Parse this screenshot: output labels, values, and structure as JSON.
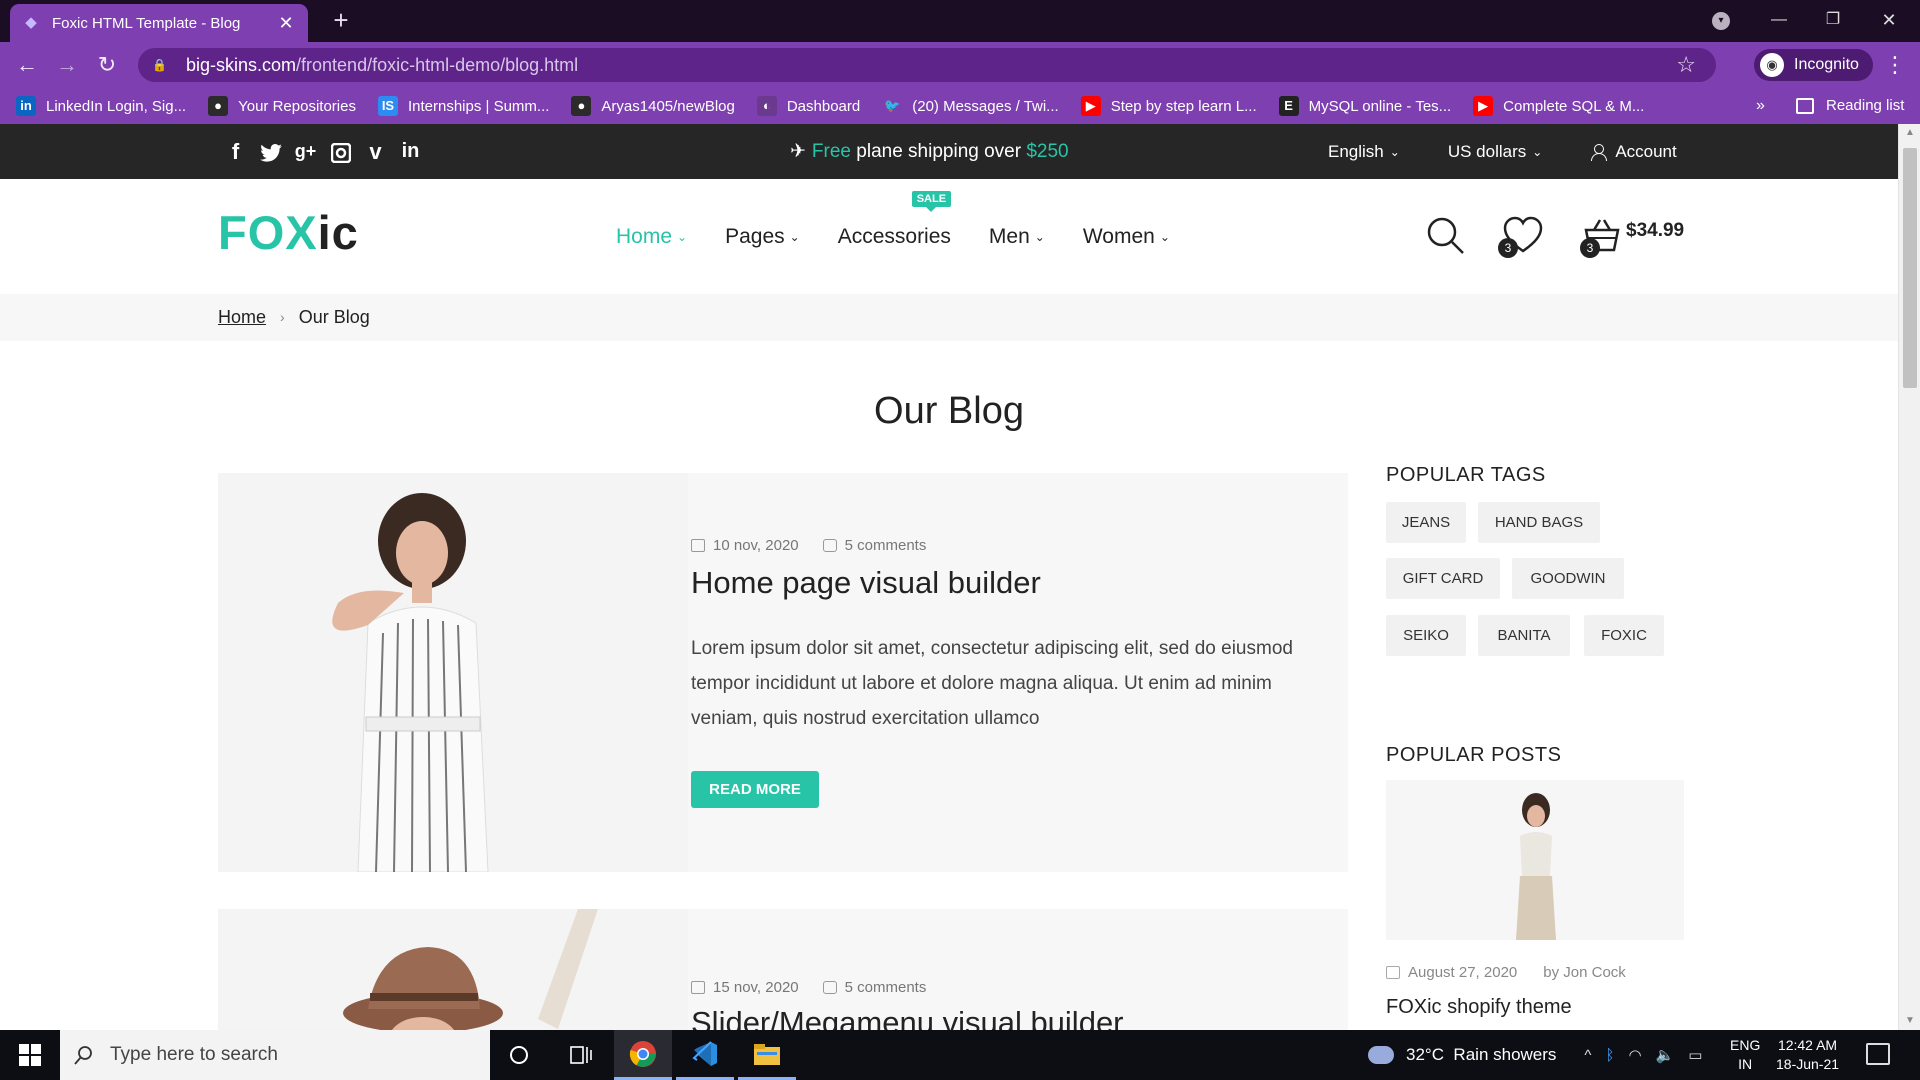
{
  "browser": {
    "tab_title": "Foxic HTML Template - Blog",
    "tab_close": "✕",
    "new_tab": "+",
    "url_host": "big-skins.com",
    "url_path": "/frontend/foxic-html-demo/blog.html",
    "profile_label": "Incognito",
    "bookmarks": [
      {
        "label": "LinkedIn Login, Sig...",
        "icon": "in",
        "color": "#0a66c2"
      },
      {
        "label": "Your Repositories",
        "icon": "●",
        "color": "#2b2b2b"
      },
      {
        "label": "Internships | Summ...",
        "icon": "IS",
        "color": "#2c8cf4"
      },
      {
        "label": "Aryas1405/newBlog",
        "icon": "●",
        "color": "#2b2b2b"
      },
      {
        "label": "Dashboard",
        "icon": "◐",
        "color": "#6b3a8f"
      },
      {
        "label": "(20) Messages / Twi...",
        "icon": "🐦",
        "color": "#7e3fb0"
      },
      {
        "label": "Step by step learn L...",
        "icon": "▶",
        "color": "#ff0000"
      },
      {
        "label": "MySQL online - Tes...",
        "icon": "E",
        "color": "#222222"
      },
      {
        "label": "Complete SQL & M...",
        "icon": "▶",
        "color": "#ff0000"
      }
    ],
    "bookmarks_more": "»",
    "reading_list": "Reading list"
  },
  "topbar": {
    "promo_free": "Free",
    "promo_mid": " plane shipping over ",
    "promo_amount": "$250",
    "language": "English",
    "currency": "US dollars",
    "account": "Account"
  },
  "header": {
    "logo_part1": "FOX",
    "logo_part2": "ic",
    "nav": [
      {
        "label": "Home",
        "active": true,
        "dropdown": true
      },
      {
        "label": "Pages",
        "active": false,
        "dropdown": true
      },
      {
        "label": "Accessories",
        "active": false,
        "dropdown": false,
        "badge": "SALE"
      },
      {
        "label": "Men",
        "active": false,
        "dropdown": true
      },
      {
        "label": "Women",
        "active": false,
        "dropdown": true
      }
    ],
    "wishlist_count": "3",
    "cart_count": "3",
    "cart_total": "$34.99"
  },
  "breadcrumb": {
    "home": "Home",
    "separator": "›",
    "current": "Our Blog"
  },
  "page_title": "Our Blog",
  "posts": [
    {
      "date": "10 nov, 2020",
      "comments": "5 comments",
      "title": "Home page visual builder",
      "excerpt": "Lorem ipsum dolor sit amet, consectetur adipiscing elit, sed do eiusmod tempor incididunt ut labore et dolore magna aliqua. Ut enim ad minim veniam, quis nostrud exercitation ullamco",
      "button": "READ MORE"
    },
    {
      "date": "15 nov, 2020",
      "comments": "5 comments",
      "title": "Slider/Megamenu visual builder"
    }
  ],
  "sidebar": {
    "tags_title": "POPULAR TAGS",
    "tags": [
      "JEANS",
      "HAND BAGS",
      "GIFT CARD",
      "GOODWIN",
      "SEIKO",
      "BANITA",
      "FOXIC"
    ],
    "posts_title": "POPULAR POSTS",
    "popular_post": {
      "date": "August 27, 2020",
      "author": "by Jon Cock",
      "title": "FOXic shopify theme"
    }
  },
  "taskbar": {
    "search_placeholder": "Type here to search",
    "weather": "32°C  Rain showers",
    "lang_top": "ENG",
    "lang_bottom": "IN",
    "time": "12:42 AM",
    "date": "18-Jun-21"
  },
  "colors": {
    "accent": "#27c4a8",
    "browser_purple": "#7e3fb0",
    "topbar_dark": "#262626"
  }
}
